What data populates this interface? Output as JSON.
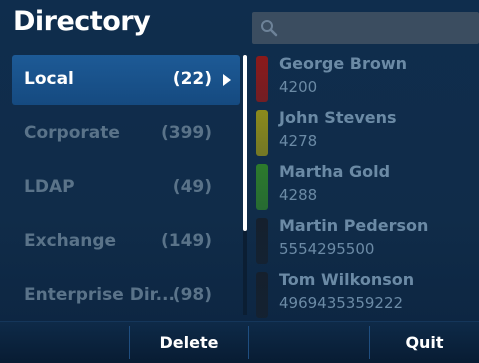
{
  "header": {
    "title": "Directory",
    "search": {
      "value": "",
      "icon": "search-icon"
    }
  },
  "categories": [
    {
      "label": "Local",
      "count": "(22)",
      "active": true
    },
    {
      "label": "Corporate",
      "count": "(399)",
      "active": false
    },
    {
      "label": "LDAP",
      "count": "(49)",
      "active": false
    },
    {
      "label": "Exchange",
      "count": "(149)",
      "active": false
    },
    {
      "label": "Enterprise Dir...",
      "count": "(98)",
      "active": false
    }
  ],
  "contacts": [
    {
      "name": "George Brown",
      "number": "4200",
      "status_color": "#8b1a1a"
    },
    {
      "name": "John Stevens",
      "number": "4278",
      "status_color": "#8c8a1c"
    },
    {
      "name": "Martha Gold",
      "number": "4288",
      "status_color": "#2c7a2c"
    },
    {
      "name": "Martin Pederson",
      "number": "5554295500",
      "status_color": "#15202d"
    },
    {
      "name": "Tom Wilkonson",
      "number": "4969435359222",
      "status_color": "#15202d"
    }
  ],
  "softkeys": {
    "key1": "",
    "key2": "Delete",
    "key3": "",
    "key4": "Quit"
  },
  "colors": {
    "background": "#0f2d4d",
    "active_category": "#1d5a96",
    "inactive_text": "#5a7389",
    "contact_text": "#6b8aa5"
  }
}
